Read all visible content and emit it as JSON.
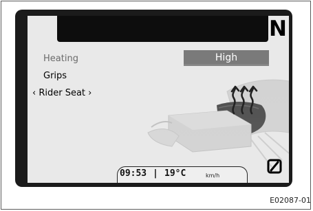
{
  "display": {
    "gear": "N",
    "menu": {
      "item_heating": "Heating",
      "item_grips": "Grips",
      "item_rider_seat": "‹ Rider Seat ›"
    },
    "selected_option": "High",
    "status": {
      "time": "09:53",
      "separator": "|",
      "temperature": "19°C",
      "speed_unit": "km/h"
    }
  },
  "caption": "E02087-01",
  "icons": [
    "heat-arrows-icon",
    "zero-slashed-icon",
    "motorcycle-seat-icon"
  ],
  "colors": {
    "bezel": "#1b1b1b",
    "screen": "#e9e9e9",
    "selected_box": "#7a7a7a"
  }
}
